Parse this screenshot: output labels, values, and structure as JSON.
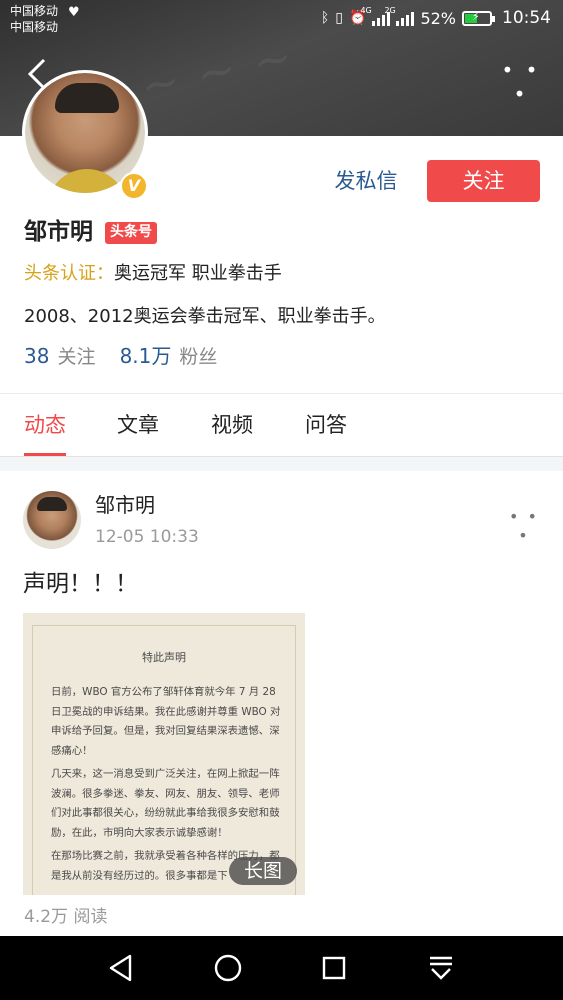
{
  "status_bar": {
    "carrier_1": "中国移动",
    "carrier_2": "中国移动",
    "hd_icon": "heart-hd-icon",
    "net_1": "4G",
    "net_2": "2G",
    "battery_percent": "52%",
    "battery_level": 0.52,
    "time": "10:54",
    "icons": [
      "bluetooth-icon",
      "vibrate-icon",
      "alarm-icon",
      "signal-icon",
      "battery-icon"
    ]
  },
  "header": {
    "back_icon": "back-chevron-icon",
    "more_icon": "more-dots-icon",
    "more_label": "• • •"
  },
  "profile": {
    "name": "邹市明",
    "tag": "头条号",
    "verify_label": "头条认证：",
    "verify_value": "奥运冠军 职业拳击手",
    "description": "2008、2012奥运会拳击冠军、职业拳击手。",
    "following_count": "38",
    "following_label": "关注",
    "followers_count": "8.1万",
    "followers_label": "粉丝",
    "message_button": "发私信",
    "follow_button": "关注",
    "badge": "V"
  },
  "tabs": [
    {
      "label": "动态",
      "active": true
    },
    {
      "label": "文章",
      "active": false
    },
    {
      "label": "视频",
      "active": false
    },
    {
      "label": "问答",
      "active": false
    }
  ],
  "post": {
    "author": "邹市明",
    "time": "12-05 10:33",
    "more_label": "• • •",
    "text": "声明！！！",
    "image": {
      "doc_title": "特此声明",
      "paragraphs": [
        "日前，WBO 官方公布了邹轩体育就今年 7 月 28 日卫冕战的申诉结果。我在此感谢并尊重 WBO 对申诉给予回复。但是，我对回复结果深表遗憾、深感痛心！",
        "几天来，这一消息受到广泛关注，在网上掀起一阵波澜。很多拳迷、拳友、网友、朋友、领导、老师们对此事都很关心，纷纷就此事给我很多安慰和鼓励，在此，市明向大家表示诚挚感谢！",
        "在那场比赛之前，我就承受着各种各样的压力，都是我从前没有经历过的。很多事都是下"
      ],
      "long_image_tag": "长图"
    },
    "reads": "4.2万 阅读"
  },
  "navbar": {
    "icons": [
      "back-triangle-icon",
      "home-circle-icon",
      "recents-square-icon",
      "notification-pull-icon"
    ]
  }
}
